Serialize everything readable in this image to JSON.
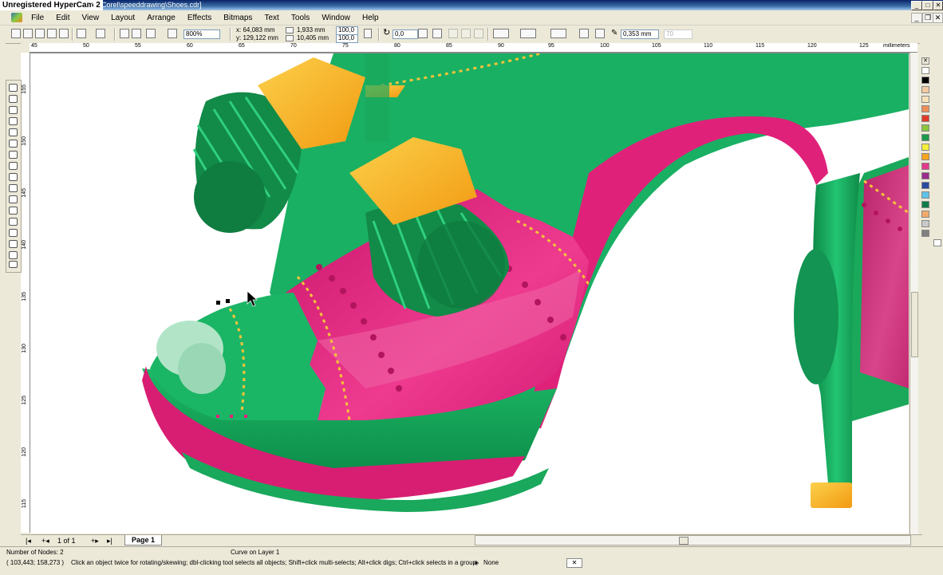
{
  "window": {
    "title_watermark": "Unregistered HyperCam 2",
    "file_path": "or_Corel\\speeddrawing\\Shoes.cdr]"
  },
  "menu": [
    "File",
    "Edit",
    "View",
    "Layout",
    "Arrange",
    "Effects",
    "Bitmaps",
    "Text",
    "Tools",
    "Window",
    "Help"
  ],
  "toolbar": {
    "zoom": "800%",
    "x": "x: 64,083 mm",
    "y": "y: 129,122 mm",
    "w": "1,933 mm",
    "h": "10,405 mm",
    "scale_w": "100,0",
    "scale_h": "100,0",
    "rotation": "0,0",
    "outline_width": "0,353 mm",
    "disabled_value": "70"
  },
  "ruler": {
    "units": "millimeters",
    "h_ticks": [
      "45",
      "50",
      "55",
      "60",
      "65",
      "70",
      "75",
      "80",
      "85",
      "90",
      "95",
      "100",
      "105",
      "110",
      "115",
      "120",
      "125"
    ],
    "v_ticks": [
      "155",
      "150",
      "145",
      "140",
      "135",
      "130",
      "125",
      "120",
      "115"
    ]
  },
  "navigator": {
    "page_count": "1 of 1",
    "page_tab": "Page 1"
  },
  "status": {
    "nodes": "Number of Nodes: 2",
    "layer": "Curve on Layer 1",
    "coords": "( 103,443; 158,273 )",
    "hint": "Click an object twice for rotating/skewing; dbl-clicking tool selects all objects; Shift+click multi-selects; Alt+click digs; Ctrl+click selects in a group",
    "fill": "None"
  },
  "colors": {
    "green": "#14a85a",
    "magenta": "#e0217a",
    "gold": "#f5b21e"
  },
  "palette": [
    "#ffffff",
    "#000000",
    "#f2c9a0",
    "#f6e0b8",
    "#ee8f57",
    "#e23b2a",
    "#8cc63e",
    "#1a9a4a",
    "#f6ee3a",
    "#f9a41f",
    "#e23b8a",
    "#9b2d8b",
    "#2a4aa0",
    "#5fc2e8",
    "#0f7d4a",
    "#f3a96b",
    "#c9c9c9",
    "#808080"
  ]
}
